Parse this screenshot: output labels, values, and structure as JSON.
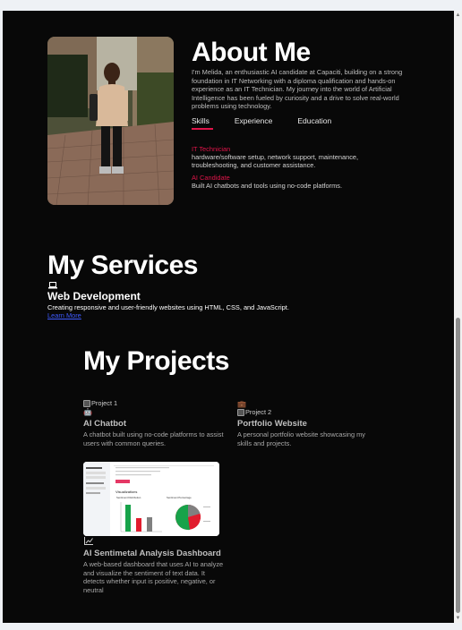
{
  "about": {
    "title": "About Me",
    "text": "I'm Melida, an enthusiastic AI candidate at Capaciti, building on a strong foundation in IT Networking with a diploma qualification and hands-on experience as an IT Technician. My journey into the world of Artificial Intelligence has been fueled by curiosity and a drive to solve real-world problems using technology.",
    "tabs": [
      "Skills",
      "Experience",
      "Education"
    ],
    "skills": [
      {
        "title": "IT Technician",
        "desc": "hardware/software setup, network support, maintenance, troubleshooting, and customer assistance."
      },
      {
        "title": "AI Candidate",
        "desc": "Built AI chatbots and tools using no-code platforms."
      }
    ]
  },
  "services": {
    "title": "My Services",
    "items": [
      {
        "icon": "laptop-icon",
        "title": "Web Development",
        "desc": "Creating responsive and user-friendly websites using HTML, CSS, and JavaScript.",
        "link": "Learn More"
      }
    ]
  },
  "projects": {
    "title": "My Projects",
    "items": [
      {
        "img_alt": "Project 1",
        "icon": "robot-icon",
        "title": "AI Chatbot",
        "desc": "A chatbot built using no-code platforms to assist users with common queries."
      },
      {
        "img_alt": "Project 2",
        "icon": "briefcase-icon",
        "title": "Portfolio Website",
        "desc": "A personal portfolio website showcasing my skills and projects."
      },
      {
        "icon": "chart-icon",
        "title": "AI Sentimetal Analysis Dashboard",
        "desc": "A web-based dashboard that uses AI to analyze and visualize the sentiment of text data. It detects whether input is positive, negative, or neutral"
      }
    ]
  },
  "dashboard_preview": {
    "heading": "Visualizations",
    "left_panel_title": "Sentiment",
    "chart_left_title": "Sentiment Distribution",
    "chart_right_title": "Sentiment Percentage"
  },
  "colors": {
    "accent": "#e0154a",
    "background": "#080808",
    "link": "#3e5bff"
  }
}
